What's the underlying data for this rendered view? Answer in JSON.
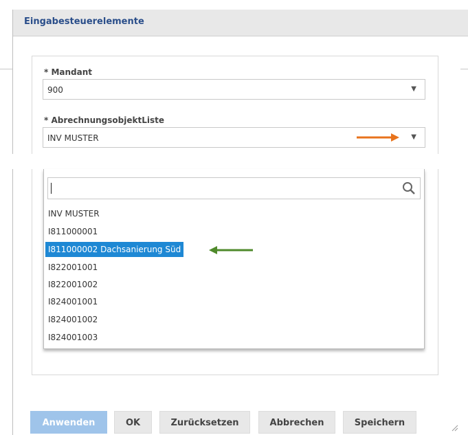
{
  "dialog": {
    "title": "Eingabesteuerelemente"
  },
  "fields": {
    "mandant": {
      "label": "* Mandant",
      "value": "900"
    },
    "abrechnungsobjekt": {
      "label": "* AbrechnungsobjektListe",
      "value": "INV MUSTER"
    }
  },
  "dropdown": {
    "search_value": "",
    "options": [
      "INV MUSTER",
      "I811000001",
      "I811000002 Dachsanierung Süd",
      "I822001001",
      "I822001002",
      "I824001001",
      "I824001002",
      "I824001003"
    ],
    "selected_index": 2
  },
  "buttons": {
    "apply": "Anwenden",
    "ok": "OK",
    "reset": "Zurücksetzen",
    "cancel": "Abbrechen",
    "save": "Speichern"
  },
  "colors": {
    "title": "#2a4e8a",
    "selection": "#1e88d4",
    "orange_arrow": "#e8731c",
    "green_arrow": "#4f8a2b",
    "primary_button": "#9fc4ea"
  },
  "icons": {
    "search": "search-icon",
    "dropdown_caret": "caret-down-icon",
    "resize": "resize-grip-icon"
  }
}
